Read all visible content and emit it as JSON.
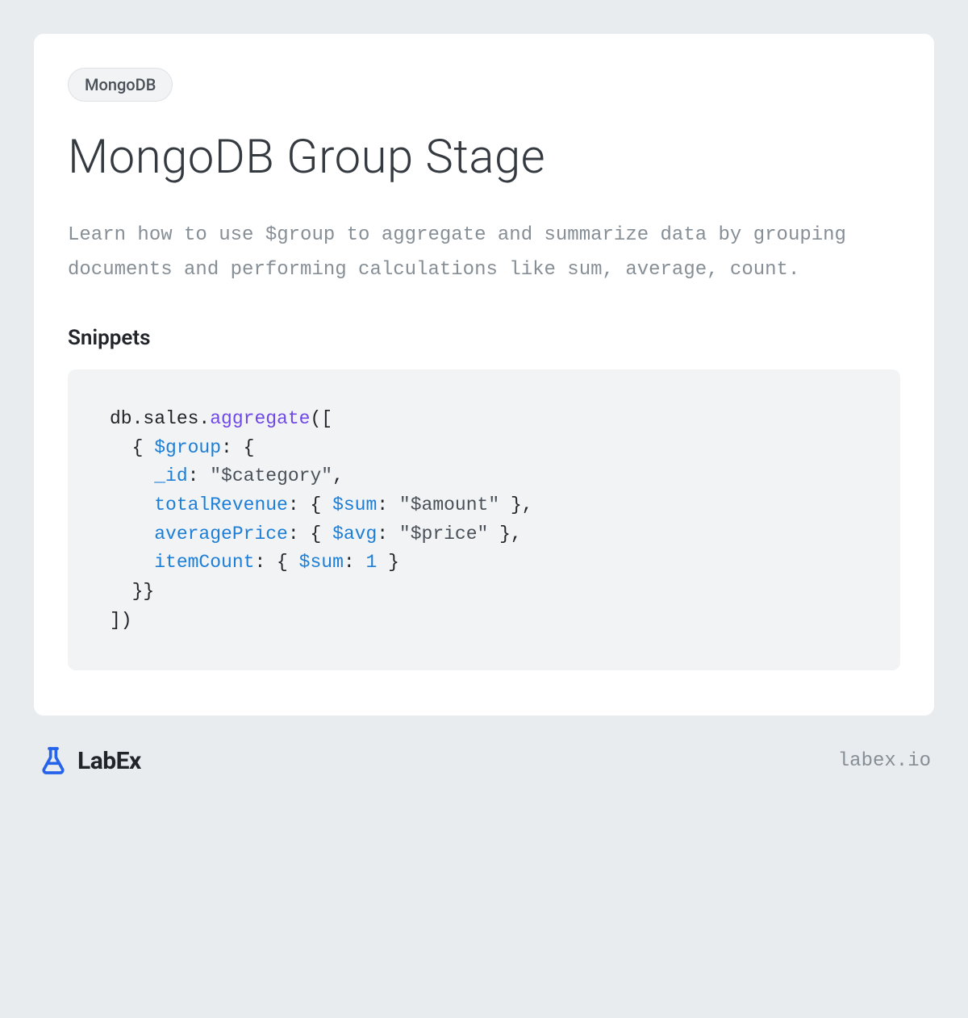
{
  "tag": "MongoDB",
  "title": "MongoDB Group Stage",
  "description": "Learn how to use $group to aggregate and summarize data by grouping documents and performing calculations like sum, average, count.",
  "snippets_heading": "Snippets",
  "code": {
    "l1_a": "db.sales.",
    "l1_b": "aggregate",
    "l1_c": "([",
    "l2_a": "  { ",
    "l2_b": "$group",
    "l2_c": ": {",
    "l3_a": "    ",
    "l3_b": "_id",
    "l3_c": ": ",
    "l3_d": "\"$category\"",
    "l3_e": ",",
    "l4_a": "    ",
    "l4_b": "totalRevenue",
    "l4_c": ": { ",
    "l4_d": "$sum",
    "l4_e": ": ",
    "l4_f": "\"$amount\"",
    "l4_g": " },",
    "l5_a": "    ",
    "l5_b": "averagePrice",
    "l5_c": ": { ",
    "l5_d": "$avg",
    "l5_e": ": ",
    "l5_f": "\"$price\"",
    "l5_g": " },",
    "l6_a": "    ",
    "l6_b": "itemCount",
    "l6_c": ": { ",
    "l6_d": "$sum",
    "l6_e": ": ",
    "l6_f": "1",
    "l6_g": " }",
    "l7": "  }}",
    "l8": "])"
  },
  "brand": "LabEx",
  "site": "labex.io"
}
